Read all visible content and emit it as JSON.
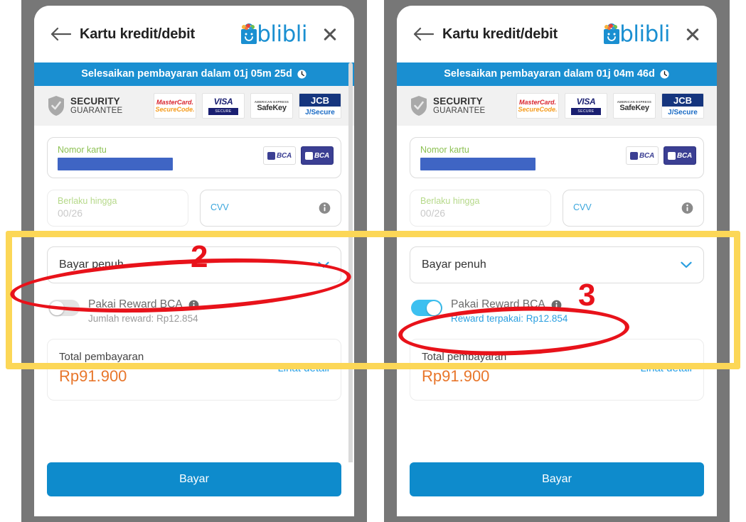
{
  "panels": [
    {
      "id": "panel-before",
      "header": {
        "title": "Kartu kredit/debit",
        "back_icon": "back-arrow-icon",
        "close_icon": "close-icon",
        "logo_text": "blibli"
      },
      "timer": {
        "text": "Selesaikan pembayaran dalam 01j 05m 25d",
        "icon": "clock-icon",
        "bg": "#1a8fd1"
      },
      "security": {
        "line1": "SECURITY",
        "line2": "GUARANTEE",
        "shield_icon": "shield-check-icon",
        "brands": [
          {
            "name": "mastercard-securecode-logo",
            "line1": "MasterCard.",
            "line2": "SecureCode."
          },
          {
            "name": "visa-secure-logo",
            "line1": "VISA",
            "line2": "SECURE"
          },
          {
            "name": "amex-safekey-logo",
            "line1": "AMERICAN EXPRESS",
            "line2": "SafeKey"
          },
          {
            "name": "jcb-jsecure-logo",
            "line1": "JCB",
            "line2": "J/Secure"
          }
        ]
      },
      "card_field": {
        "label": "Nomor kartu",
        "value_masked": true,
        "logos": [
          "bca-logo-white",
          "bca-logo-blue"
        ]
      },
      "expiry_field": {
        "label": "Berlaku hingga",
        "value": "00/26"
      },
      "cvv_field": {
        "label": "CVV",
        "value": "",
        "info_icon": "info-icon"
      },
      "installment_select": {
        "value": "Bayar penuh",
        "caret_icon": "chevron-down-icon"
      },
      "reward": {
        "toggle_state": "off",
        "label": "Pakai Reward BCA",
        "info_icon": "info-icon",
        "sub_label": "Jumlah reward: Rp12.854",
        "sub_is_blue": false
      },
      "total": {
        "label": "Total pembayaran",
        "amount": "Rp91.900",
        "link": "Lihat detail"
      },
      "pay_button": "Bayar"
    },
    {
      "id": "panel-after",
      "header": {
        "title": "Kartu kredit/debit",
        "back_icon": "back-arrow-icon",
        "close_icon": "close-icon",
        "logo_text": "blibli"
      },
      "timer": {
        "text": "Selesaikan pembayaran dalam 01j 04m 46d",
        "icon": "clock-icon",
        "bg": "#1a8fd1"
      },
      "security": {
        "line1": "SECURITY",
        "line2": "GUARANTEE",
        "shield_icon": "shield-check-icon",
        "brands": [
          {
            "name": "mastercard-securecode-logo",
            "line1": "MasterCard.",
            "line2": "SecureCode."
          },
          {
            "name": "visa-secure-logo",
            "line1": "VISA",
            "line2": "SECURE"
          },
          {
            "name": "amex-safekey-logo",
            "line1": "AMERICAN EXPRESS",
            "line2": "SafeKey"
          },
          {
            "name": "jcb-jsecure-logo",
            "line1": "JCB",
            "line2": "J/Secure"
          }
        ]
      },
      "card_field": {
        "label": "Nomor kartu",
        "value_masked": true,
        "logos": [
          "bca-logo-white",
          "bca-logo-blue"
        ]
      },
      "expiry_field": {
        "label": "Berlaku hingga",
        "value": "00/26"
      },
      "cvv_field": {
        "label": "CVV",
        "value": "",
        "info_icon": "info-icon"
      },
      "installment_select": {
        "value": "Bayar penuh",
        "caret_icon": "chevron-down-icon"
      },
      "reward": {
        "toggle_state": "on",
        "label": "Pakai Reward BCA",
        "info_icon": "info-icon",
        "sub_label": "Reward terpakai: Rp12.854",
        "sub_is_blue": true
      },
      "total": {
        "label": "Total pembayaran",
        "amount": "Rp91.900",
        "link": "Lihat detail"
      },
      "pay_button": "Bayar"
    }
  ],
  "annotations": {
    "highlight_box_color": "#fcd757",
    "circle_color": "#e8121a",
    "steps": [
      {
        "number": "2",
        "target": "installment-select-left"
      },
      {
        "number": "3",
        "target": "reward-row-right"
      }
    ]
  }
}
